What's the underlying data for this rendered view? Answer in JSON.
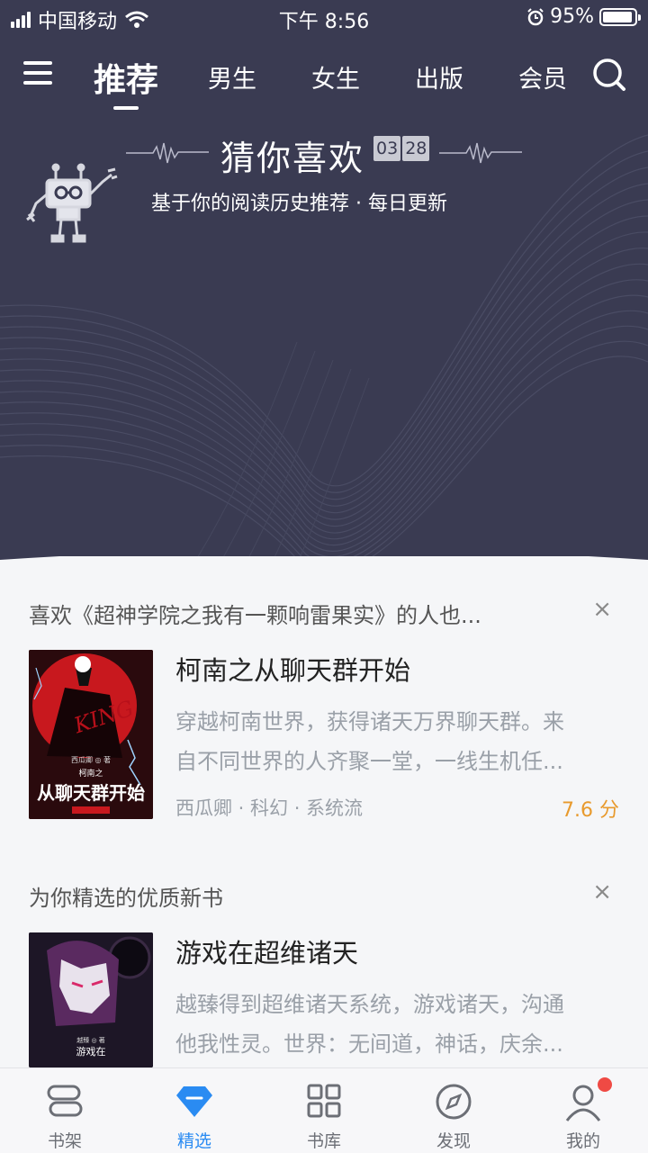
{
  "status_bar": {
    "carrier": "中国移动",
    "time": "下午 8:56",
    "battery": "95%",
    "battery_level": 0.95
  },
  "top_nav": {
    "tabs": [
      "推荐",
      "男生",
      "女生",
      "出版",
      "会员"
    ],
    "active_tab": "推荐"
  },
  "hero": {
    "title": "猜你喜欢",
    "date_month": "03",
    "date_day": "28",
    "subtitle": "基于你的阅读历史推荐 · 每日更新",
    "background_color": "#3a3b52"
  },
  "sections": [
    {
      "header": "喜欢《超神学院之我有一颗响雷果实》的人也...",
      "close": "×",
      "book": {
        "title": "柯南之从聊天群开始",
        "desc_line1": "穿越柯南世界，获得诸天万界聊天群。来",
        "desc_line2": "自不同世界的人齐聚一堂，一线生机任...",
        "meta": "西瓜卿 · 科幻 · 系统流",
        "score": "7.6 分",
        "cover_author": "西瓜卿 ◎ 著",
        "cover_text_top": "柯南之",
        "cover_text_main": "从聊天群开始",
        "cover_logo": "KING"
      }
    },
    {
      "header": "为你精选的优质新书",
      "close": "×",
      "book": {
        "title": "游戏在超维诸天",
        "desc_line1": "越臻得到超维诸天系统，游戏诸天，沟通",
        "desc_line2": "他我性灵。世界：无间道，神话，庆余...",
        "cover_author": "越臻 ◎ 著",
        "cover_text": "游戏在"
      }
    }
  ],
  "bottom_bar": {
    "items": [
      {
        "label": "书架",
        "icon": "bookshelf-icon"
      },
      {
        "label": "精选",
        "icon": "diamond-icon"
      },
      {
        "label": "书库",
        "icon": "grid-icon"
      },
      {
        "label": "发现",
        "icon": "compass-icon"
      },
      {
        "label": "我的",
        "icon": "person-icon"
      }
    ],
    "active": "精选",
    "accent_color": "#2a8bf2",
    "badge_color": "#ef4a44"
  }
}
